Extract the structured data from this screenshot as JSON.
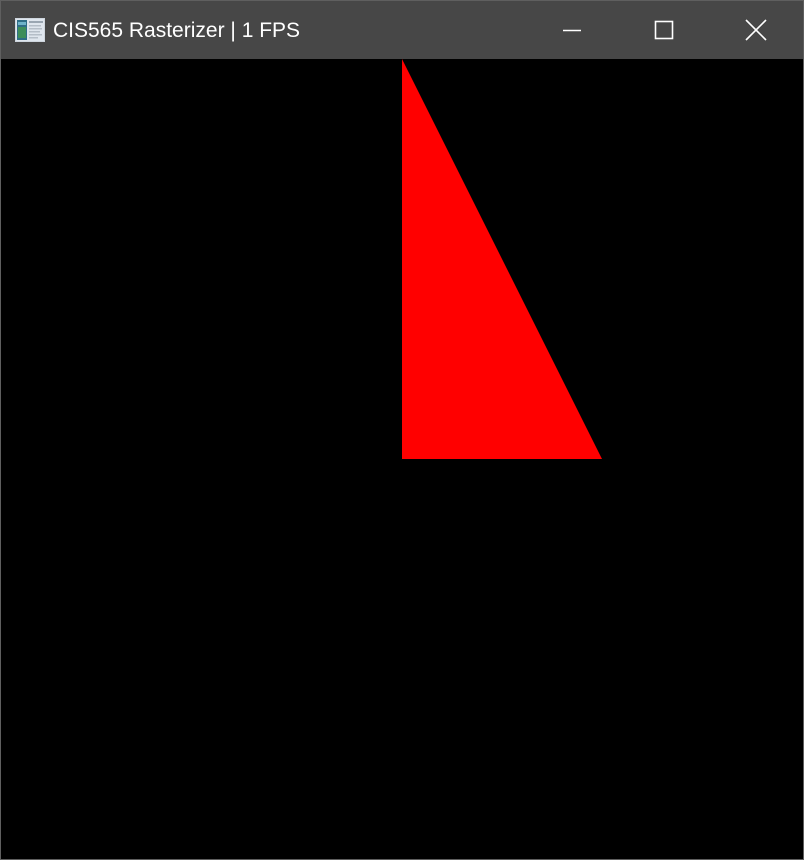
{
  "window": {
    "title": "CIS565 Rasterizer | 1 FPS",
    "app_icon": "app-window-icon",
    "controls": {
      "minimize_icon": "minimize-icon",
      "maximize_icon": "maximize-icon",
      "close_icon": "close-icon"
    },
    "colors": {
      "titlebar": "#474747",
      "title_text": "#ffffff",
      "canvas_background": "#000000"
    }
  },
  "scene": {
    "primitives": [
      {
        "shape": "triangle",
        "fill": "#ff0000"
      }
    ]
  }
}
